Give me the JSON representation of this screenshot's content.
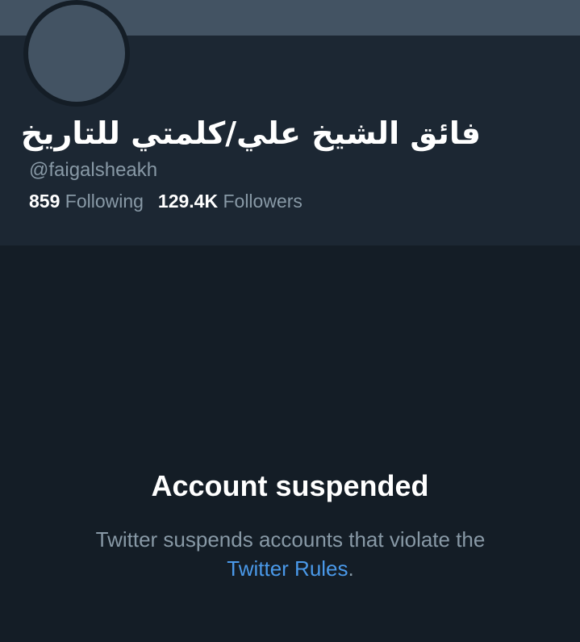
{
  "profile": {
    "display_name": "فائق الشيخ علي/كلمتي للتاريخ",
    "handle": "@faigalsheakh",
    "following_count": "859",
    "following_label": "Following",
    "followers_count": "129.4K",
    "followers_label": "Followers"
  },
  "suspension": {
    "title": "Account suspended",
    "message": "Twitter suspends accounts that violate the",
    "link_text": "Twitter Rules",
    "period": "."
  },
  "colors": {
    "background": "#141d26",
    "card": "#1c2733",
    "banner": "#435363",
    "muted_text": "#8899a6",
    "link": "#4a99e9"
  }
}
